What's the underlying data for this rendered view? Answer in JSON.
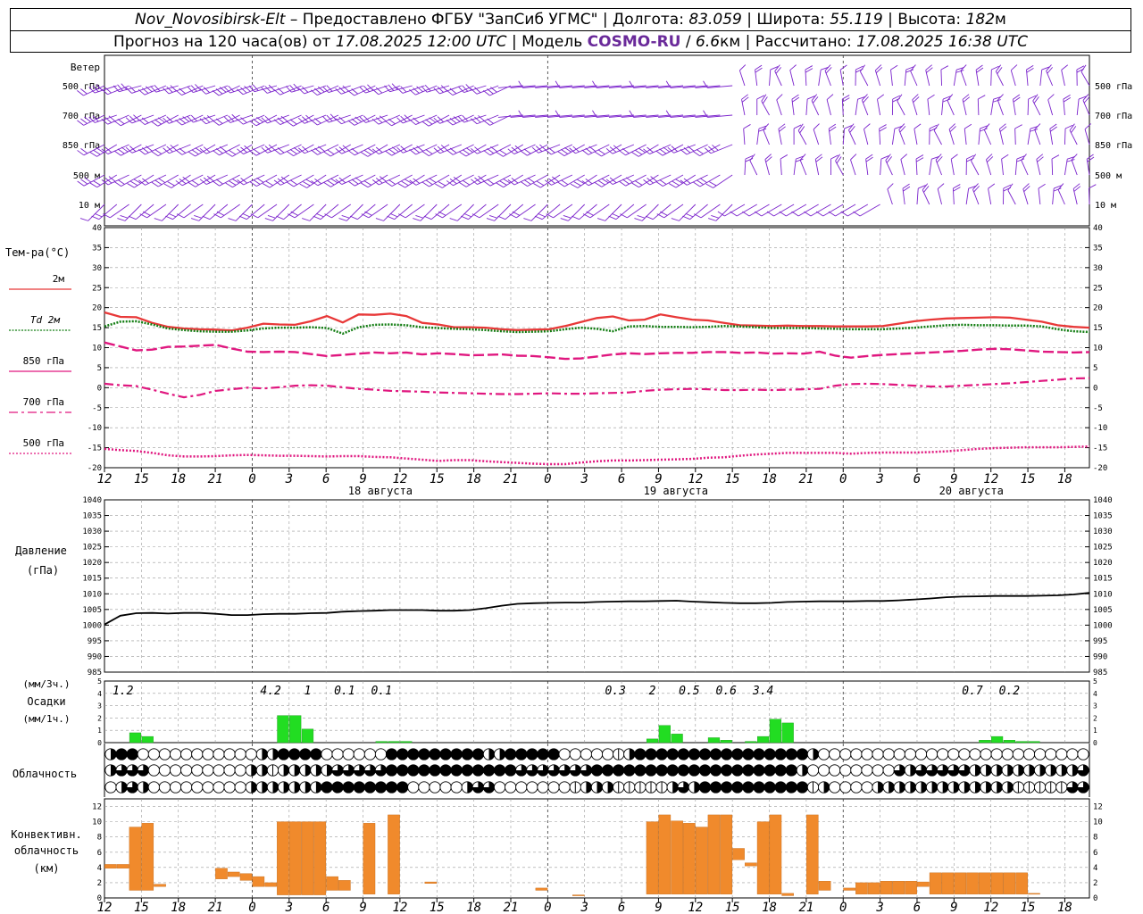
{
  "header": {
    "station": "Nov_Novosibirsk-Elt",
    "dash": "–",
    "provider": "Предоставлено ФГБУ \"ЗапСиб УГМС\"",
    "lon_label": "Долгота:",
    "lon_value": "83.059",
    "lat_label": "Широта:",
    "lat_value": "55.119",
    "alt_label": "Высота:",
    "alt_value": "182",
    "alt_unit": "м",
    "forecast_label": "Прогноз на 120 часа(ов) от",
    "forecast_start": "17.08.2025 12:00 UTC",
    "model_label": "Модель",
    "model_name": "COSMO-RU",
    "model_res": "6.6",
    "model_res_unit": "км",
    "calc_label": "Рассчитано:",
    "calc_time": "17.08.2025 16:38 UTC",
    "sep": "|"
  },
  "colors": {
    "wind": "#7a22cc",
    "t2m": "#e83838",
    "td2m": "#127d12",
    "t850": "#e0177f",
    "t700": "#e0177f",
    "t500": "#e0177f",
    "pressure": "#000000",
    "precip": "#22dd22",
    "conv_cloud": "#f08a2c",
    "grid": "#9a9a9a"
  },
  "chart_data": {
    "type": "meteogram",
    "time_ticks": [
      "12",
      "15",
      "18",
      "21",
      "0",
      "3",
      "6",
      "9",
      "12",
      "15",
      "18",
      "21",
      "0",
      "3",
      "6",
      "9",
      "12",
      "15",
      "18",
      "21",
      "0",
      "3",
      "6",
      "9",
      "12",
      "15",
      "18"
    ],
    "day_labels": [
      "18 августа",
      "19 августа",
      "20 августа"
    ],
    "wind": {
      "title": "Ветер",
      "levels": [
        "500 гПа",
        "700 гПа",
        "850 гПа",
        "500 м",
        "10 м"
      ]
    },
    "temperature": {
      "title": "Тем-ра(°C)",
      "ylim": [
        -20,
        40
      ],
      "yticks": [
        "40",
        "35",
        "30",
        "25",
        "20",
        "15",
        "10",
        "5",
        "0",
        "-5",
        "-10",
        "-15",
        "-20"
      ],
      "series": [
        {
          "name": "2м",
          "key": "t2m",
          "style": "solid",
          "values": [
            18.8,
            17.7,
            17.6,
            16.2,
            15.2,
            14.8,
            14.6,
            14.5,
            14.3,
            15.0,
            16.0,
            15.8,
            15.7,
            16.6,
            17.9,
            16.3,
            18.3,
            18.2,
            18.5,
            17.9,
            16.2,
            15.8,
            15.1,
            15.1,
            15.0,
            14.6,
            14.4,
            14.5,
            14.6,
            15.4,
            16.4,
            17.4,
            17.8,
            16.8,
            17.0,
            18.3,
            17.6,
            17.0,
            16.8,
            16.2,
            15.6,
            15.5,
            15.4,
            15.5,
            15.4,
            15.4,
            15.3,
            15.3,
            15.3,
            15.4,
            16.0,
            16.6,
            17.0,
            17.3,
            17.4,
            17.5,
            17.6,
            17.5,
            17.0,
            16.5,
            15.6,
            15.2,
            15.0
          ]
        },
        {
          "name": "Td 2м",
          "key": "td2m",
          "style": "dotted",
          "values": [
            15.3,
            16.5,
            16.6,
            15.8,
            14.8,
            14.4,
            14.1,
            14.0,
            14.0,
            14.3,
            14.8,
            15.0,
            15.0,
            15.1,
            14.9,
            13.5,
            15.1,
            15.7,
            15.8,
            15.6,
            15.1,
            14.9,
            14.7,
            14.6,
            14.4,
            14.1,
            13.9,
            14.0,
            14.1,
            14.6,
            15.0,
            14.7,
            14.1,
            15.3,
            15.4,
            15.2,
            15.2,
            15.1,
            15.2,
            15.4,
            15.3,
            15.1,
            14.9,
            14.9,
            14.9,
            14.8,
            14.7,
            14.6,
            14.6,
            14.6,
            14.8,
            15.0,
            15.3,
            15.6,
            15.7,
            15.6,
            15.6,
            15.5,
            15.5,
            15.3,
            14.6,
            14.1,
            13.9
          ]
        },
        {
          "name": "850 гПа",
          "key": "t850",
          "style": "dashed",
          "values": [
            11.3,
            10.3,
            9.3,
            9.5,
            10.2,
            10.3,
            10.5,
            10.7,
            9.8,
            9.0,
            8.9,
            9.0,
            8.9,
            8.4,
            7.9,
            8.2,
            8.5,
            8.8,
            8.6,
            8.8,
            8.3,
            8.6,
            8.4,
            8.1,
            8.2,
            8.3,
            8.0,
            7.9,
            7.6,
            7.2,
            7.3,
            7.8,
            8.3,
            8.6,
            8.4,
            8.6,
            8.7,
            8.7,
            8.9,
            8.9,
            8.7,
            8.8,
            8.5,
            8.6,
            8.5,
            9.0,
            8.0,
            7.5,
            7.9,
            8.2,
            8.4,
            8.6,
            8.8,
            9.0,
            9.2,
            9.5,
            9.7,
            9.6,
            9.3,
            9.0,
            8.9,
            8.8,
            8.9
          ]
        },
        {
          "name": "700 гПа",
          "key": "t700",
          "style": "dashdot",
          "values": [
            1.0,
            0.6,
            0.4,
            -0.5,
            -1.5,
            -2.4,
            -1.8,
            -0.8,
            -0.4,
            0.0,
            -0.2,
            0.1,
            0.5,
            0.6,
            0.5,
            0.1,
            -0.3,
            -0.5,
            -0.8,
            -0.9,
            -1.0,
            -1.2,
            -1.3,
            -1.4,
            -1.5,
            -1.6,
            -1.6,
            -1.5,
            -1.4,
            -1.5,
            -1.5,
            -1.4,
            -1.3,
            -1.2,
            -0.8,
            -0.5,
            -0.4,
            -0.3,
            -0.4,
            -0.6,
            -0.6,
            -0.5,
            -0.6,
            -0.5,
            -0.4,
            -0.3,
            0.5,
            0.9,
            1.0,
            0.9,
            0.7,
            0.5,
            0.3,
            0.3,
            0.5,
            0.7,
            0.9,
            1.1,
            1.4,
            1.7,
            2.0,
            2.3,
            2.4
          ]
        },
        {
          "name": "500 гПа",
          "key": "t500",
          "style": "dotted",
          "values": [
            -15.3,
            -15.6,
            -15.8,
            -16.3,
            -16.9,
            -17.2,
            -17.2,
            -17.1,
            -16.9,
            -16.8,
            -16.9,
            -17.0,
            -17.0,
            -17.1,
            -17.2,
            -17.1,
            -17.1,
            -17.3,
            -17.4,
            -17.7,
            -18.0,
            -18.3,
            -18.1,
            -18.1,
            -18.4,
            -18.6,
            -18.8,
            -19.0,
            -19.1,
            -19.1,
            -18.7,
            -18.4,
            -18.2,
            -18.2,
            -18.1,
            -18.0,
            -17.9,
            -17.8,
            -17.5,
            -17.4,
            -17.0,
            -16.7,
            -16.5,
            -16.3,
            -16.3,
            -16.3,
            -16.3,
            -16.5,
            -16.3,
            -16.2,
            -16.2,
            -16.2,
            -16.1,
            -15.9,
            -15.6,
            -15.3,
            -15.1,
            -15.0,
            -14.9,
            -14.9,
            -14.9,
            -14.8,
            -14.7
          ]
        }
      ]
    },
    "pressure": {
      "title": "Давление",
      "unit": "(гПа)",
      "ylim": [
        985,
        1040
      ],
      "yticks": [
        "1040",
        "1035",
        "1030",
        "1025",
        "1020",
        "1015",
        "1010",
        "1005",
        "1000",
        "995",
        "990",
        "985"
      ],
      "values": [
        1000.2,
        1003.0,
        1003.8,
        1003.9,
        1003.7,
        1003.9,
        1003.9,
        1003.6,
        1003.2,
        1003.2,
        1003.5,
        1003.6,
        1003.6,
        1003.8,
        1003.9,
        1004.3,
        1004.5,
        1004.6,
        1004.8,
        1004.8,
        1004.8,
        1004.6,
        1004.6,
        1004.8,
        1005.4,
        1006.2,
        1006.8,
        1007.0,
        1007.1,
        1007.2,
        1007.2,
        1007.4,
        1007.5,
        1007.6,
        1007.6,
        1007.7,
        1007.8,
        1007.5,
        1007.3,
        1007.1,
        1007.0,
        1007.0,
        1007.1,
        1007.4,
        1007.5,
        1007.6,
        1007.6,
        1007.6,
        1007.7,
        1007.7,
        1007.9,
        1008.2,
        1008.5,
        1008.9,
        1009.1,
        1009.2,
        1009.3,
        1009.3,
        1009.3,
        1009.4,
        1009.5,
        1009.8,
        1010.3
      ]
    },
    "precipitation": {
      "title": "Осадки",
      "unit3h": "(мм/3ч.)",
      "unit1h": "(мм/1ч.)",
      "ylim": [
        0,
        5
      ],
      "yticks": [
        "5",
        "4",
        "3",
        "2",
        "1",
        "0"
      ],
      "three_hour_labels": [
        "1.2",
        "4.2",
        "1",
        "0.1",
        "0.1",
        "0.3",
        "2",
        "0.5",
        "0.6",
        "3.4",
        "0.7",
        "0.2"
      ],
      "hourly": [
        {
          "h": 2,
          "v": 0.8
        },
        {
          "h": 3,
          "v": 0.5
        },
        {
          "h": 14,
          "v": 2.2
        },
        {
          "h": 15,
          "v": 2.2
        },
        {
          "h": 16,
          "v": 1.1
        },
        {
          "h": 22,
          "v": 0.1
        },
        {
          "h": 23,
          "v": 0.1
        },
        {
          "h": 24,
          "v": 0.1
        },
        {
          "h": 44,
          "v": 0.3
        },
        {
          "h": 45,
          "v": 1.4
        },
        {
          "h": 46,
          "v": 0.7
        },
        {
          "h": 49,
          "v": 0.4
        },
        {
          "h": 50,
          "v": 0.2
        },
        {
          "h": 52,
          "v": 0.1
        },
        {
          "h": 53,
          "v": 0.5
        },
        {
          "h": 54,
          "v": 1.9
        },
        {
          "h": 55,
          "v": 1.6
        },
        {
          "h": 71,
          "v": 0.2
        },
        {
          "h": 72,
          "v": 0.5
        },
        {
          "h": 73,
          "v": 0.2
        },
        {
          "h": 74,
          "v": 0.1
        },
        {
          "h": 75,
          "v": 0.1
        }
      ]
    },
    "cloudiness": {
      "title": "Облачность",
      "rows": [
        "2440000000000022444400000044444444422444440000012444444444444444420000000000000000000000000",
        "2333000000000221222223333344444444444433333334444444444444444444200000000323333322222222223",
        "0232000000000222222244444444000002330000000122211111232444444444412000022222222222221111133"
      ]
    },
    "convective_cloud": {
      "title": "Конвективн. облачность",
      "unit": "(км)",
      "ylim": [
        0,
        13
      ],
      "yticks": [
        "12",
        "10",
        "8",
        "6",
        "4",
        "2",
        "0"
      ],
      "bars": [
        {
          "h": 0,
          "b": 3.9,
          "t": 4.4
        },
        {
          "h": 1,
          "b": 3.9,
          "t": 4.4
        },
        {
          "h": 2,
          "b": 1.0,
          "t": 9.3
        },
        {
          "h": 3,
          "b": 1.0,
          "t": 9.8
        },
        {
          "h": 4,
          "b": 1.5,
          "t": 1.8
        },
        {
          "h": 9,
          "b": 2.5,
          "t": 3.9
        },
        {
          "h": 10,
          "b": 2.8,
          "t": 3.4
        },
        {
          "h": 11,
          "b": 2.3,
          "t": 3.2
        },
        {
          "h": 12,
          "b": 1.5,
          "t": 2.8
        },
        {
          "h": 13,
          "b": 1.5,
          "t": 2.0
        },
        {
          "h": 14,
          "b": 0.4,
          "t": 10.0
        },
        {
          "h": 15,
          "b": 0.4,
          "t": 10.0
        },
        {
          "h": 16,
          "b": 0.4,
          "t": 10.0
        },
        {
          "h": 17,
          "b": 0.4,
          "t": 10.0
        },
        {
          "h": 18,
          "b": 1.0,
          "t": 2.8
        },
        {
          "h": 19,
          "b": 1.0,
          "t": 2.3
        },
        {
          "h": 21,
          "b": 0.5,
          "t": 9.8
        },
        {
          "h": 23,
          "b": 0.5,
          "t": 10.9
        },
        {
          "h": 26,
          "b": 1.9,
          "t": 2.1
        },
        {
          "h": 35,
          "b": 1.0,
          "t": 1.3
        },
        {
          "h": 38,
          "b": 0.3,
          "t": 0.4
        },
        {
          "h": 44,
          "b": 0.5,
          "t": 10.0
        },
        {
          "h": 45,
          "b": 0.5,
          "t": 10.9
        },
        {
          "h": 46,
          "b": 0.5,
          "t": 10.1
        },
        {
          "h": 47,
          "b": 0.5,
          "t": 9.8
        },
        {
          "h": 48,
          "b": 0.5,
          "t": 9.3
        },
        {
          "h": 49,
          "b": 0.5,
          "t": 10.9
        },
        {
          "h": 50,
          "b": 0.5,
          "t": 10.9
        },
        {
          "h": 51,
          "b": 5.0,
          "t": 6.5
        },
        {
          "h": 52,
          "b": 4.2,
          "t": 4.6
        },
        {
          "h": 53,
          "b": 0.5,
          "t": 10.0
        },
        {
          "h": 54,
          "b": 0.5,
          "t": 10.9
        },
        {
          "h": 55,
          "b": 0.3,
          "t": 0.6
        },
        {
          "h": 57,
          "b": 0.5,
          "t": 10.9
        },
        {
          "h": 58,
          "b": 1.0,
          "t": 2.2
        },
        {
          "h": 60,
          "b": 1.0,
          "t": 1.3
        },
        {
          "h": 61,
          "b": 0.5,
          "t": 2.0
        },
        {
          "h": 62,
          "b": 0.5,
          "t": 2.0
        },
        {
          "h": 63,
          "b": 0.5,
          "t": 2.2
        },
        {
          "h": 64,
          "b": 0.5,
          "t": 2.2
        },
        {
          "h": 65,
          "b": 0.5,
          "t": 2.2
        },
        {
          "h": 66,
          "b": 1.5,
          "t": 2.1
        },
        {
          "h": 67,
          "b": 0.5,
          "t": 3.3
        },
        {
          "h": 68,
          "b": 0.5,
          "t": 3.3
        },
        {
          "h": 69,
          "b": 0.5,
          "t": 3.3
        },
        {
          "h": 70,
          "b": 0.5,
          "t": 3.3
        },
        {
          "h": 71,
          "b": 0.5,
          "t": 3.3
        },
        {
          "h": 72,
          "b": 0.5,
          "t": 3.3
        },
        {
          "h": 73,
          "b": 0.5,
          "t": 3.3
        },
        {
          "h": 74,
          "b": 0.5,
          "t": 3.3
        },
        {
          "h": 75,
          "b": 0.5,
          "t": 0.6
        }
      ]
    }
  }
}
